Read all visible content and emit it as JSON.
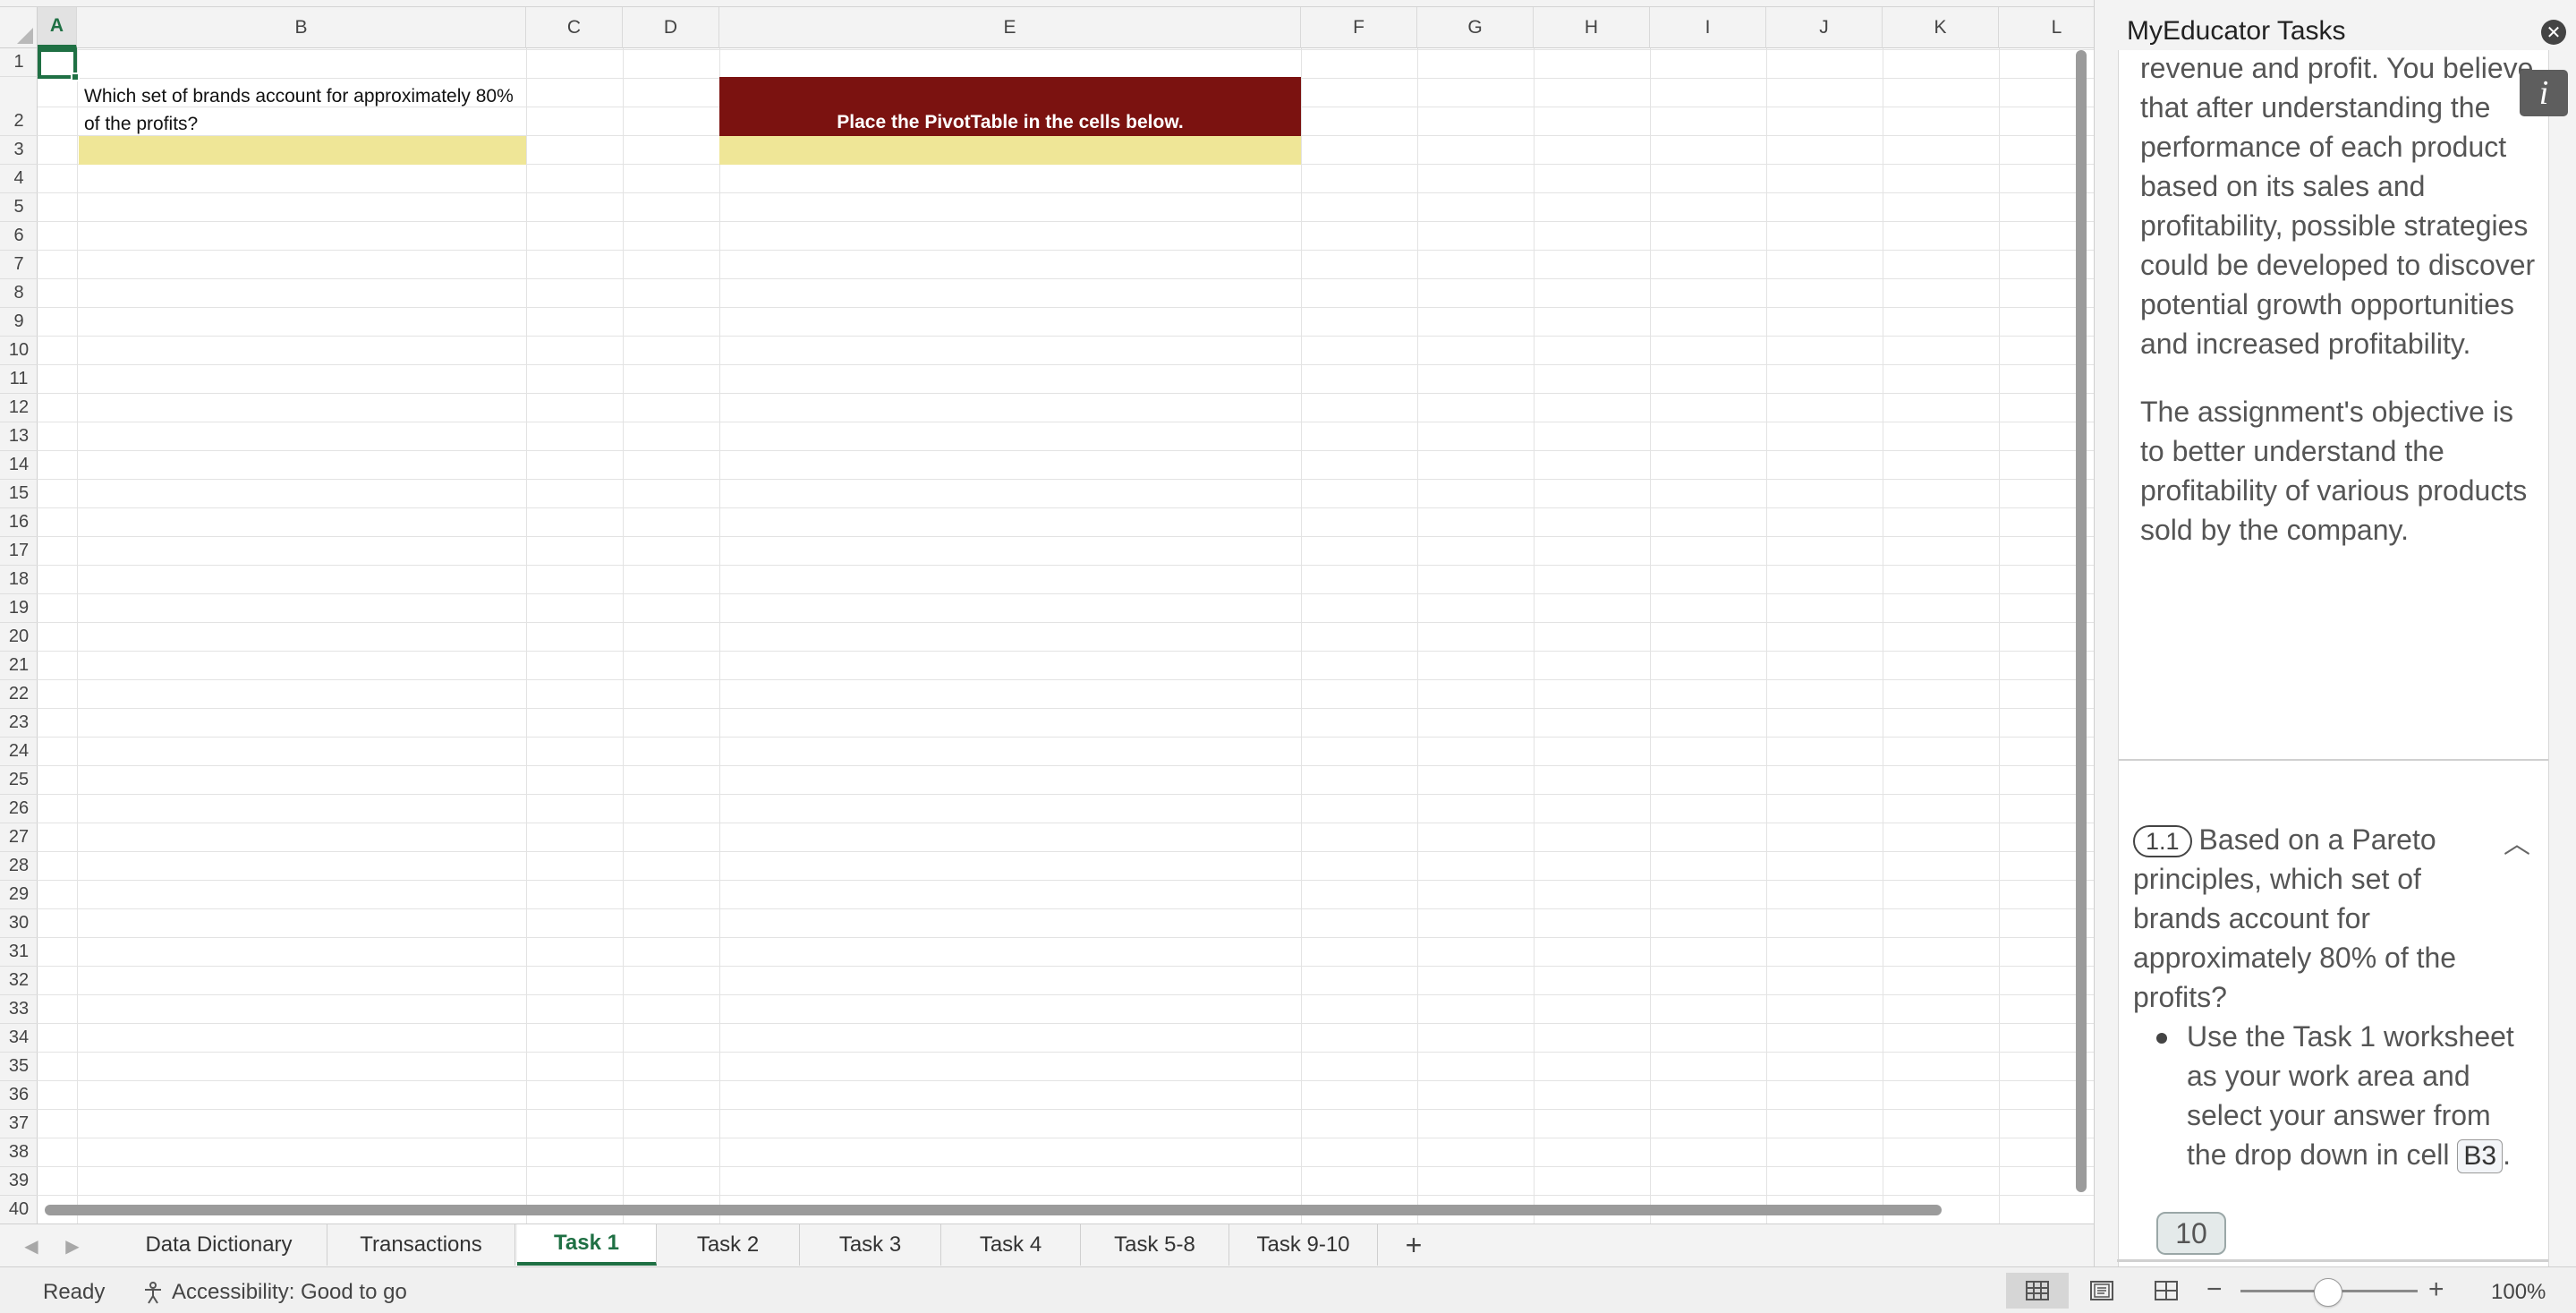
{
  "columns": [
    "A",
    "B",
    "C",
    "D",
    "E",
    "F",
    "G",
    "H",
    "I",
    "J",
    "K",
    "L"
  ],
  "active_column": "A",
  "rows": [
    "1",
    "2",
    "3",
    "4",
    "5",
    "6",
    "7",
    "8",
    "9",
    "10",
    "11",
    "12",
    "13",
    "14",
    "15",
    "16",
    "17",
    "18",
    "19",
    "20",
    "21",
    "22",
    "23",
    "24",
    "25",
    "26",
    "27",
    "28",
    "29",
    "30",
    "31",
    "32",
    "33",
    "34",
    "35",
    "36",
    "37",
    "38",
    "39",
    "40"
  ],
  "cells": {
    "B2": "Which set of brands account for approximately 80% of the profits?",
    "E2": "Place the PivotTable in the cells below."
  },
  "sheet_tabs": [
    "Data Dictionary",
    "Transactions",
    "Task 1",
    "Task 2",
    "Task 3",
    "Task 4",
    "Task 5-8",
    "Task 9-10"
  ],
  "active_tab": "Task 1",
  "task_pane": {
    "title": "MyEducator Tasks",
    "intro_paragraph_1": "revenue and profit. You believe that after understanding the performance of each product based on its sales and profitability, possible strategies could be developed to discover potential growth opportunities and increased profitability.",
    "intro_paragraph_2": "The assignment's objective is to better understand the profitability of various products sold by the company.",
    "task_number": "1.1",
    "task_question": "Based on a Pareto principles, which set of brands account for approximately 80% of the profits?",
    "task_bullet_prefix": "Use the Task 1 worksheet as your work area and select your answer from the drop down in cell",
    "task_cell_ref": "B3",
    "task_bullet_suffix": ".",
    "points": "10"
  },
  "status": {
    "ready": "Ready",
    "accessibility": "Accessibility: Good to go",
    "zoom": "100%",
    "zoom_level": 1.0
  },
  "colors": {
    "accent_green": "#1f7044",
    "header_fill": "#7b1210",
    "answer_fill": "#efe697"
  }
}
